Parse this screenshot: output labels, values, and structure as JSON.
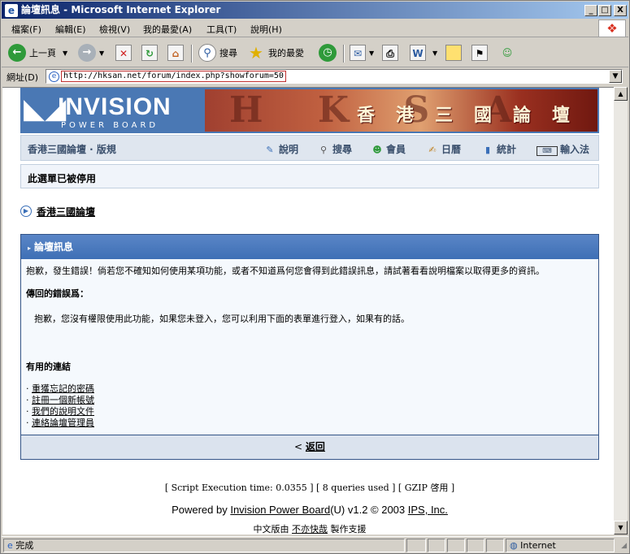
{
  "window": {
    "title": "論壇訊息 - Microsoft Internet Explorer",
    "controls": {
      "minimize": "_",
      "maximize": "□",
      "close": "X"
    }
  },
  "menubar": [
    "檔案(F)",
    "編輯(E)",
    "檢視(V)",
    "我的最愛(A)",
    "工具(T)",
    "說明(H)"
  ],
  "toolbar": {
    "back": "上一頁",
    "search": "搜尋",
    "favorites": "我的最愛"
  },
  "addressbar": {
    "label": "網址(D)",
    "url": "http://hksan.net/forum/index.php?showforum=50"
  },
  "banner": {
    "logo_big": "INVISION",
    "logo_small": "POWER BOARD",
    "banner_latin": "H K S A N",
    "banner_title": "香港三國論壇"
  },
  "nav": {
    "board_rules": "香港三國論壇 · 版規",
    "items": [
      {
        "icon": "help-icon",
        "label": "說明"
      },
      {
        "icon": "search-icon",
        "label": "搜尋"
      },
      {
        "icon": "members-icon",
        "label": "會員"
      },
      {
        "icon": "calendar-icon",
        "label": "日曆"
      },
      {
        "icon": "stats-icon",
        "label": "統計"
      },
      {
        "icon": "keyboard-icon",
        "label": "輸入法"
      }
    ]
  },
  "notice": "此選單已被停用",
  "breadcrumb": "香港三國論壇",
  "error": {
    "header": "論壇訊息",
    "intro": "抱歉，發生錯誤！倘若您不確知如何使用某項功能，或者不知道爲何您會得到此錯誤訊息，請試著看看說明檔案以取得更多的資訊。",
    "label": "傳回的錯誤爲：",
    "message": "抱歉，您沒有權限使用此功能，如果您未登入，您可以利用下面的表單進行登入，如果有的話。",
    "links_header": "有用的連結",
    "links": [
      "重獲忘記的密碼",
      "註冊一個新帳號",
      "我們的說明文件",
      "連絡論壇管理員"
    ],
    "back_prefix": "< ",
    "back_label": "返回"
  },
  "footer": {
    "stats": "[ Script Execution time: 0.0355 ]   [ 8 queries used ]   [ GZIP 啓用 ]",
    "powered_prefix": "Powered by ",
    "powered_link": "Invision Power Board",
    "powered_suffix": "(U) v1.2 © 2003  ",
    "company": "IPS, Inc.",
    "chinese_prefix": "中文版由 ",
    "chinese_link": "不亦快哉",
    "chinese_suffix": " 製作支援"
  },
  "statusbar": {
    "status": "完成",
    "zone": "Internet"
  }
}
